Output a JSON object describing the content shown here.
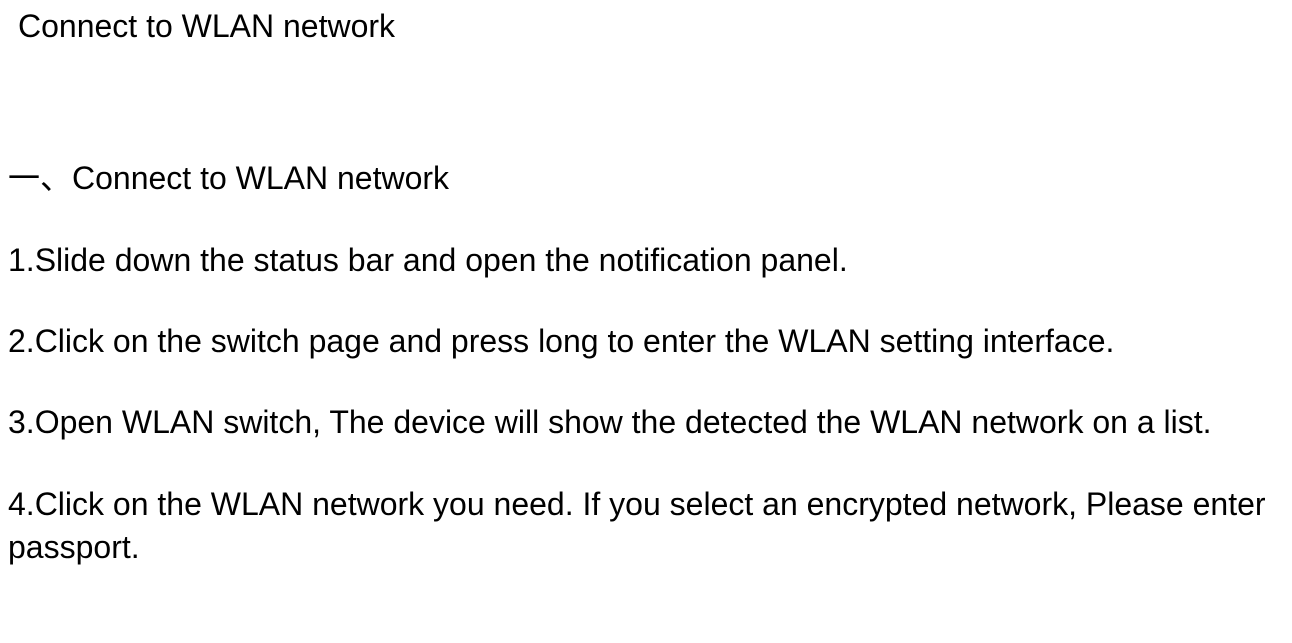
{
  "title": "Connect to WLAN network",
  "section_heading": "一、Connect to WLAN network",
  "steps": {
    "s1": "1.Slide down the status bar and open the notification panel.",
    "s2": "2.Click on the switch page and press long to enter the WLAN setting interface.",
    "s3": "3.Open WLAN switch, The device will show the detected the WLAN network on a list.",
    "s4": "4.Click on the WLAN network you need. If you select an encrypted network, Please enter passport."
  }
}
